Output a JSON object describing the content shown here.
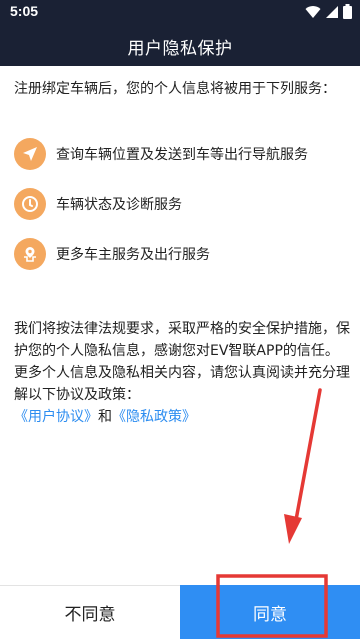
{
  "status_bar": {
    "time": "5:05"
  },
  "header": {
    "title": "用户隐私保护"
  },
  "intro": "注册绑定车辆后，您的个人信息将被用于下列服务：",
  "services": [
    {
      "icon": "send-arrow-icon",
      "label": "查询车辆位置及发送到车等出行导航服务"
    },
    {
      "icon": "clock-icon",
      "label": "车辆状态及诊断服务"
    },
    {
      "icon": "location-icon",
      "label": "更多车主服务及出行服务"
    }
  ],
  "policy": {
    "paragraph1": "我们将按法律法规要求，采取严格的安全保护措施，保护您的个人隐私信息，感谢您对EV智联APP的信任。",
    "paragraph2": "更多个人信息及隐私相关内容，请您认真阅读并充分理解以下协议及政策：",
    "user_agreement_link": "《用户协议》",
    "conjunction": "和",
    "privacy_policy_link": "《隐私政策》"
  },
  "buttons": {
    "disagree": "不同意",
    "agree": "同意"
  },
  "colors": {
    "header_bg": "#1a2134",
    "accent_blue": "#2f8ef3",
    "icon_orange": "#f4a85f",
    "link_blue": "#2d8df0",
    "annotation_red": "#e53935"
  }
}
